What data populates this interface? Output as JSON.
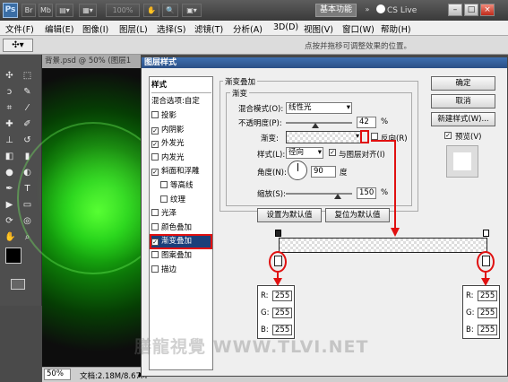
{
  "titlebar": {
    "logo": "Ps",
    "zoom": "100%",
    "workspace": "基本功能",
    "cslive": "CS Live",
    "win_min": "–",
    "win_max": "□",
    "win_close": "×"
  },
  "menubar": [
    "文件(F)",
    "编辑(E)",
    "图像(I)",
    "图层(L)",
    "选择(S)",
    "滤镜(T)",
    "分析(A)",
    "3D(D)",
    "视图(V)",
    "窗口(W)",
    "帮助(H)"
  ],
  "optionsbar": {
    "hint": "点按并拖移可调整效果的位置。"
  },
  "document": {
    "tab": "背景.psd @ 50% (图层1",
    "zoom": "50%",
    "docinfo": "文档:2.18M/8.67M"
  },
  "dialog": {
    "title": "图层样式",
    "styles_header": "样式",
    "blend_options": "混合选项:自定",
    "styles": [
      {
        "label": "投影",
        "checked": false,
        "indent": false
      },
      {
        "label": "内阴影",
        "checked": true,
        "indent": false
      },
      {
        "label": "外发光",
        "checked": true,
        "indent": false
      },
      {
        "label": "内发光",
        "checked": false,
        "indent": false
      },
      {
        "label": "斜面和浮雕",
        "checked": true,
        "indent": false
      },
      {
        "label": "等高线",
        "checked": false,
        "indent": true
      },
      {
        "label": "纹理",
        "checked": false,
        "indent": true
      },
      {
        "label": "光泽",
        "checked": false,
        "indent": false
      },
      {
        "label": "颜色叠加",
        "checked": false,
        "indent": false
      },
      {
        "label": "渐变叠加",
        "checked": true,
        "indent": false,
        "selected": true
      },
      {
        "label": "图案叠加",
        "checked": false,
        "indent": false
      },
      {
        "label": "描边",
        "checked": false,
        "indent": false
      }
    ],
    "section_title": "渐变叠加",
    "group_title": "渐变",
    "blend_mode_label": "混合模式(O):",
    "blend_mode_value": "线性光",
    "opacity_label": "不透明度(P):",
    "opacity_value": "42",
    "percent": "%",
    "gradient_label": "渐变:",
    "reverse_label": "反向(R)",
    "style_label": "样式(L):",
    "style_value": "径向",
    "align_label": "与图层对齐(I)",
    "angle_label": "角度(N):",
    "angle_value": "90",
    "degree": "度",
    "scale_label": "缩放(S):",
    "scale_value": "150",
    "set_default": "设置为默认值",
    "reset_default": "复位为默认值",
    "ok": "确定",
    "cancel": "取消",
    "new_style": "新建样式(W)...",
    "preview": "预览(V)"
  },
  "color_stops": {
    "left": {
      "R": "255",
      "G": "255",
      "B": "255"
    },
    "right": {
      "R": "255",
      "G": "255",
      "B": "255"
    },
    "labels": {
      "R": "R:",
      "G": "G:",
      "B": "B:"
    }
  },
  "watermark": "膳龍視覺 WWW.TLVI.NET"
}
